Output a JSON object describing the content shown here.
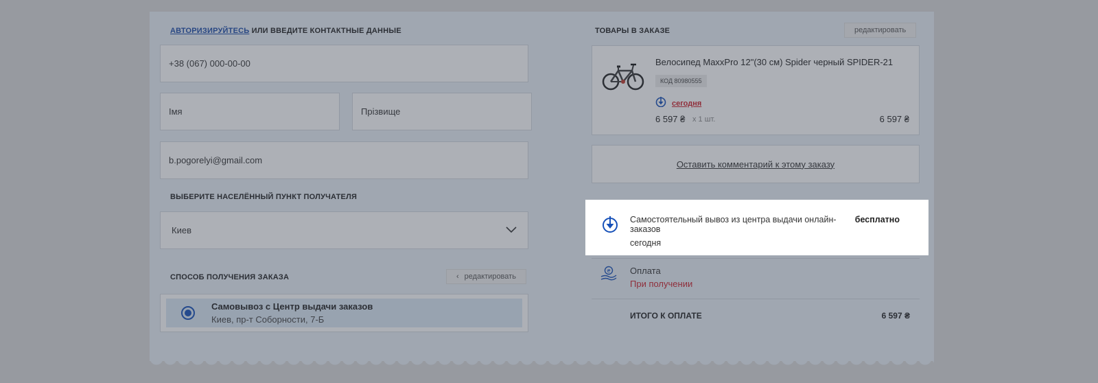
{
  "contact": {
    "auth_link": "АВТОРИЗИРУЙТЕСЬ",
    "title_rest": " ИЛИ ВВЕДИТЕ КОНТАКТНЫЕ ДАННЫЕ",
    "phone": "+38 (067) 000-00-00",
    "first_name_placeholder": "Імя",
    "last_name_placeholder": "Прізвище",
    "email": "b.pogorelyi@gmail.com"
  },
  "city": {
    "title": "ВЫБЕРИТЕ НАСЕЛЁННЫЙ ПУНКТ ПОЛУЧАТЕЛЯ",
    "value": "Киев"
  },
  "delivery": {
    "title": "СПОСОБ ПОЛУЧЕНИЯ ЗАКАЗА",
    "edit_label": "редактировать",
    "edit_chevron": "‹",
    "option_name": "Самовывоз с Центр выдачи заказов",
    "option_address": "Киев, пр-т Соборности, 7-Б"
  },
  "order": {
    "title": "ТОВАРЫ В ЗАКАЗЕ",
    "edit_label": "редактировать",
    "product_name": "Велосипед MaxxPro 12\"(30 см) Spider черный SPIDER-21",
    "product_code": "КОД 80980555",
    "availability": "сегодня",
    "unit_price": "6 597 ₴",
    "quantity": "x 1 шт.",
    "line_total": "6 597 ₴",
    "comment_link": "Оставить комментарий к этому заказу"
  },
  "pickup": {
    "title": "Самостоятельный вывоз из центра выдачи онлайн-заказов",
    "date": "сегодня",
    "price": "бесплатно"
  },
  "payment": {
    "title": "Оплата",
    "method": "При получении"
  },
  "total": {
    "label": "ИТОГО К ОПЛАТЕ",
    "value": "6 597 ₴"
  },
  "colors": {
    "accent_blue": "#1650b8",
    "alert_red": "#cc1f2a",
    "overlay": "rgba(60,66,80,0.42)"
  }
}
